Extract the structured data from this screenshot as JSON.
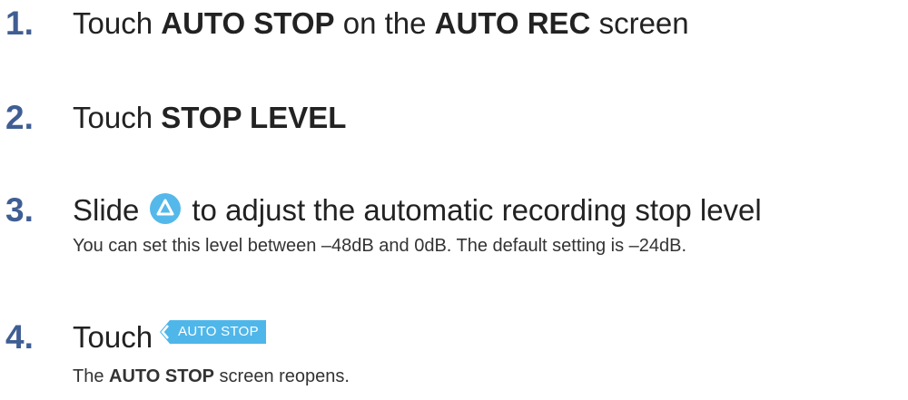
{
  "steps": [
    {
      "number": "1.",
      "title_parts": [
        "Touch ",
        "AUTO STOP",
        " on the ",
        "AUTO REC",
        " screen"
      ]
    },
    {
      "number": "2.",
      "title_parts": [
        "Touch ",
        "STOP LEVEL"
      ]
    },
    {
      "number": "3.",
      "title_before_icon": "Slide",
      "title_after_icon": "to adjust the automatic recording stop level",
      "icon": "slider-up-triangle-icon",
      "description": "You can set this level between –48dB and 0dB. The default setting is –24dB."
    },
    {
      "number": "4.",
      "title_before_button": "Touch",
      "button_label": "AUTO STOP",
      "description_parts": [
        "The ",
        "AUTO STOP",
        " screen reopens."
      ]
    }
  ],
  "colors": {
    "step_number": "#3f5e93",
    "accent_blue": "#4fb6ea",
    "text": "#222222"
  }
}
